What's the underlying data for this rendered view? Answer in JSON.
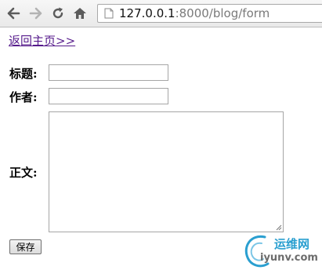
{
  "browser": {
    "url_host": "127.0.0.1",
    "url_rest": ":8000/blog/form",
    "icons": [
      "back-icon",
      "forward-icon",
      "reload-icon",
      "home-icon",
      "page-icon"
    ]
  },
  "page": {
    "home_link": "返回主页>>",
    "title_label": "标题:",
    "author_label": "作者:",
    "body_label": "正文:",
    "title_value": "",
    "author_value": "",
    "body_value": "",
    "save_button": "保存"
  },
  "watermark": {
    "cn": "运维网",
    "en": "iyunv.com"
  }
}
